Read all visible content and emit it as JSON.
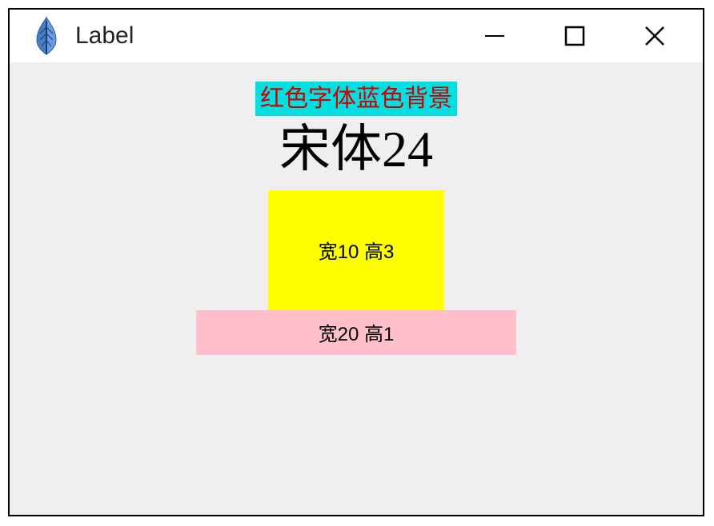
{
  "window": {
    "title": "Label"
  },
  "labels": {
    "label1": "红色字体蓝色背景",
    "label2": "宋体24",
    "label3": "宽10 高3",
    "label4": "宽20 高1"
  },
  "colors": {
    "label1_bg": "#00e0e0",
    "label1_fg": "#d00000",
    "label3_bg": "#ffff00",
    "label4_bg": "#ffc0cb",
    "client_bg": "#efefef"
  }
}
